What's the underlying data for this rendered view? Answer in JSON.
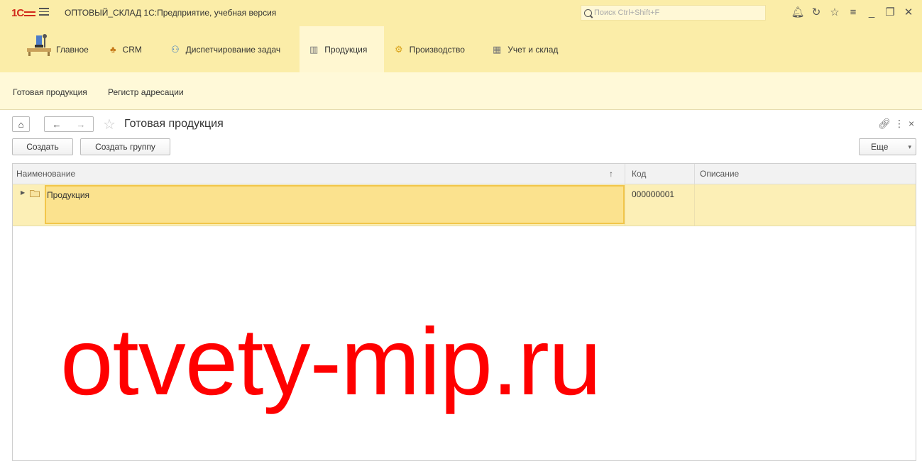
{
  "titlebar": {
    "app_title": "ОПТОВЫЙ_СКЛАД 1С:Предприятие, учебная версия",
    "search_placeholder": "Поиск Ctrl+Shift+F",
    "logo_text": "1С"
  },
  "sections": [
    {
      "label": "Главное",
      "icon": "desk-icon"
    },
    {
      "label": "CRM",
      "icon": "people-icon"
    },
    {
      "label": "Диспетчирование задач",
      "icon": "dispatch-icon"
    },
    {
      "label": "Продукция",
      "icon": "table-icon",
      "active": true
    },
    {
      "label": "Производство",
      "icon": "production-icon"
    },
    {
      "label": "Учет и склад",
      "icon": "grid-icon"
    }
  ],
  "subnav": {
    "items": [
      "Готовая продукция",
      "Регистр адресации"
    ]
  },
  "form": {
    "title": "Готовая продукция",
    "create_label": "Создать",
    "create_group_label": "Создать группу",
    "more_label": "Еще"
  },
  "table": {
    "columns": [
      {
        "label": "Наименование",
        "sort": "↑"
      },
      {
        "label": "Код"
      },
      {
        "label": "Описание"
      }
    ],
    "rows": [
      {
        "name": "Продукция",
        "code": "000000001",
        "description": "",
        "type": "folder"
      }
    ]
  },
  "watermark": "otvety-mip.ru",
  "colors": {
    "header_bg": "#fbeda8",
    "subnav_bg": "#fff9d8",
    "selection": "#fbe28e",
    "watermark": "#ff0000"
  }
}
